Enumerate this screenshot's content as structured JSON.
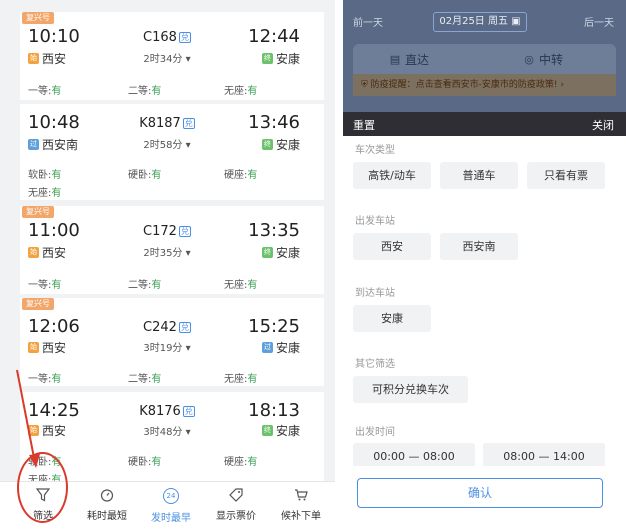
{
  "left": {
    "trains": [
      {
        "badge": "复兴号",
        "dep_time": "10:10",
        "dep_station": "西安",
        "dep_type": "始",
        "train_no": "C168",
        "dui": "兑",
        "duration": "2时34分",
        "arr_time": "12:44",
        "arr_station": "安康",
        "arr_type": "终",
        "seats": [
          {
            "name": "一等:",
            "status": "有"
          },
          {
            "name": "二等:",
            "status": "有"
          },
          {
            "name": "无座:",
            "status": "有"
          }
        ]
      },
      {
        "badge": "",
        "dep_time": "10:48",
        "dep_station": "西安南",
        "dep_type": "过",
        "train_no": "K8187",
        "dui": "兑",
        "duration": "2时58分",
        "arr_time": "13:46",
        "arr_station": "安康",
        "arr_type": "终",
        "seats": [
          {
            "name": "软卧:",
            "status": "有"
          },
          {
            "name": "硬卧:",
            "status": "有"
          },
          {
            "name": "硬座:",
            "status": "有"
          },
          {
            "name": "无座:",
            "status": "有"
          }
        ]
      },
      {
        "badge": "复兴号",
        "dep_time": "11:00",
        "dep_station": "西安",
        "dep_type": "始",
        "train_no": "C172",
        "dui": "兑",
        "duration": "2时35分",
        "arr_time": "13:35",
        "arr_station": "安康",
        "arr_type": "终",
        "seats": [
          {
            "name": "一等:",
            "status": "有"
          },
          {
            "name": "二等:",
            "status": "有"
          },
          {
            "name": "无座:",
            "status": "有"
          }
        ]
      },
      {
        "badge": "复兴号",
        "dep_time": "12:06",
        "dep_station": "西安",
        "dep_type": "始",
        "train_no": "C242",
        "dui": "兑",
        "duration": "3时19分",
        "arr_time": "15:25",
        "arr_station": "安康",
        "arr_type": "过",
        "seats": [
          {
            "name": "一等:",
            "status": "有"
          },
          {
            "name": "二等:",
            "status": "有"
          },
          {
            "name": "无座:",
            "status": "有"
          }
        ]
      },
      {
        "badge": "",
        "dep_time": "14:25",
        "dep_station": "西安",
        "dep_type": "始",
        "train_no": "K8176",
        "dui": "兑",
        "duration": "3时48分",
        "arr_time": "18:13",
        "arr_station": "安康",
        "arr_type": "终",
        "seats": [
          {
            "name": "软卧:",
            "status": "有"
          },
          {
            "name": "硬卧:",
            "status": "有"
          },
          {
            "name": "硬座:",
            "status": "有"
          },
          {
            "name": "无座:",
            "status": "有"
          }
        ]
      }
    ],
    "tabbar": {
      "filter": "筛选",
      "shortest": "耗时最短",
      "earliest": "发时最早",
      "earliest_icon_text": "24",
      "show_price": "显示票价",
      "waitlist": "候补下单"
    }
  },
  "right": {
    "prev_day": "前一天",
    "date": "02月25日 周五",
    "next_day": "后一天",
    "mode_direct": "直达",
    "mode_transfer": "中转",
    "notice": "防疫提醒：点击查看西安市-安康市的防疫政策!",
    "reset": "重置",
    "close": "关闭",
    "train_type_label": "车次类型",
    "train_types": [
      "高铁/动车",
      "普通车",
      "只看有票"
    ],
    "dep_station_label": "出发车站",
    "dep_stations": [
      "西安",
      "西安南"
    ],
    "arr_station_label": "到达车站",
    "arr_stations": [
      "安康"
    ],
    "other_label": "其它筛选",
    "other_options": [
      "可积分兑换车次"
    ],
    "dep_time_label": "出发时间",
    "dep_times": [
      "00:00 — 08:00",
      "08:00 — 14:00"
    ],
    "confirm": "确认"
  },
  "colors": {
    "available": "#3a9e52",
    "accent": "#4a90e2",
    "highlight": "#d93a2a"
  }
}
